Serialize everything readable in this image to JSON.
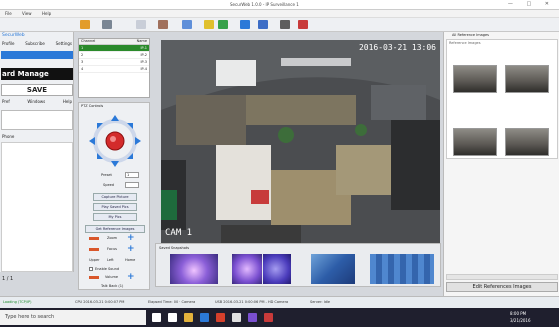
{
  "window": {
    "title": "SecurWeb 1.0.0 - IP Surveillance 1",
    "controls": "— □ ✕"
  },
  "menu": [
    "File",
    "View",
    "Help"
  ],
  "left": {
    "app_name": "SecurWeb",
    "items": [
      "Profile",
      "Subscribe",
      "Settings"
    ],
    "brand": "ard Manage",
    "save": "SAVE",
    "labels": [
      "Pref",
      "Windows",
      "Help"
    ],
    "phone_label": "Phone",
    "pager": "1 / 1"
  },
  "cameras": {
    "panel": "Channels",
    "cols": [
      "Channel",
      "Name"
    ],
    "rows": [
      [
        "1",
        "IP-1"
      ],
      [
        "2",
        "IP-2"
      ],
      [
        "3",
        "IP-3"
      ],
      [
        "4",
        "IP-4"
      ]
    ]
  },
  "ptz": {
    "title": "PTZ Controls",
    "labels": [
      "Preset",
      "Speed",
      "Capture Picture",
      "Play Saved Pics",
      "My Pics",
      "Get Reference Images",
      "Zoom",
      "Focus",
      "Iris"
    ],
    "preset_value": "1",
    "quick": [
      "Upper",
      "Left",
      "Home"
    ],
    "enable_sound": "Enable Sound",
    "volume": "Volume",
    "talk": "Talk Back (1)"
  },
  "video": {
    "timestamp": "2016-03-21 13:06",
    "cam_label": "CAM 1"
  },
  "thumbs": {
    "title": "Saved Snapshots"
  },
  "refs": {
    "title": "All Reference Images",
    "sub": "Reference Images",
    "edit": "Edit References Images"
  },
  "status": [
    "Loading (TCP/IP)",
    "CPU 2016-03-21 0:00:07 PM",
    "Elapsed Time: 00 · Camera",
    "USB 2016-03-21 0:00:06 PM - HD Camera",
    "Server: Idle"
  ],
  "taskbar": {
    "search": "Type here to search",
    "time": "8:00 PM",
    "date": "3/21/2016"
  },
  "colors": {
    "accent": "#2b79d8",
    "video_bg": "#3a3c3e"
  }
}
